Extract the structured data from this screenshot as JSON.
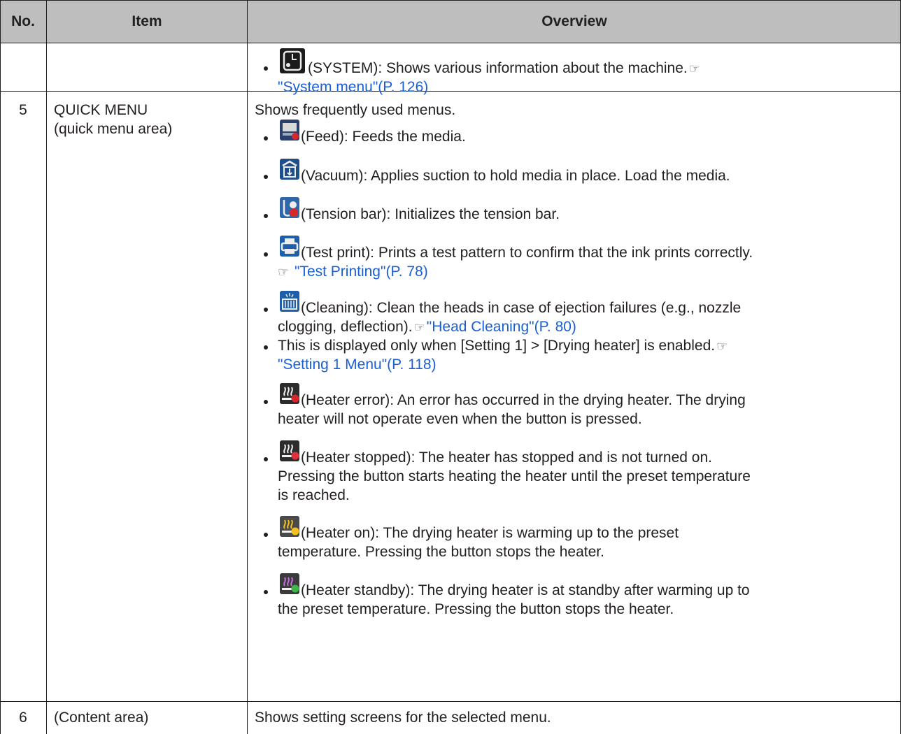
{
  "table": {
    "headers": {
      "no": "No.",
      "item": "Item",
      "overview": "Overview"
    },
    "rows": [
      {
        "no": "",
        "item_lines": [
          "",
          ""
        ],
        "overview": {
          "intro": "",
          "bullets": [
            {
              "icon": "system-icon",
              "text": "(SYSTEM): Shows various information about the machine.",
              "ref_glyph": "☞",
              "link": "\"System menu\"(P. 126)"
            }
          ]
        }
      },
      {
        "no": "5",
        "item_lines": [
          "QUICK MENU",
          "(quick menu area)"
        ],
        "overview": {
          "intro": "Shows frequently used menus.",
          "bullets": [
            {
              "icon": "feed-icon",
              "text": "(Feed): Feeds the media."
            },
            {
              "icon": "vacuum-icon",
              "text": "(Vacuum): Applies suction to hold media in place. Load the media."
            },
            {
              "icon": "tension-bar-icon",
              "text": "(Tension bar): Initializes the tension bar."
            },
            {
              "icon": "test-print-icon",
              "text": "(Test print): Prints a test pattern to confirm that the ink prints correctly.",
              "ref_glyph": "☞",
              "link": "\"Test Printing\"(P. 78)"
            },
            {
              "icon": "cleaning-icon",
              "text_line1": "(Cleaning): Clean the heads in case of ejection failures (e.g., nozzle",
              "text_line2": "clogging, deflection).",
              "ref_glyph": "☞",
              "link": "\"Head Cleaning\"(P. 80)"
            },
            {
              "icon": "",
              "text": "This is displayed only when [Setting 1] > [Drying heater] is enabled.",
              "ref_glyph": "☞",
              "link": "\"Setting 1 Menu\"(P. 118)"
            },
            {
              "icon": "heater-error-icon",
              "text_line1": "(Heater error): An error has occurred in the drying heater. The drying",
              "text_line2": "heater will not operate even when the button is pressed."
            },
            {
              "icon": "heater-stopped-icon",
              "text_line1": "(Heater stopped): The heater has stopped and is not turned on.",
              "text_line2": "Pressing the button starts heating the heater until the preset temperature",
              "text_line3": "is reached."
            },
            {
              "icon": "heater-on-icon",
              "text_line1": "(Heater on): The drying heater is warming up to the preset",
              "text_line2": "temperature. Pressing the button stops the heater."
            },
            {
              "icon": "heater-standby-icon",
              "text_line1": "(Heater standby): The drying heater is at standby after warming up to",
              "text_line2": "the preset temperature. Pressing the button stops the heater."
            }
          ]
        }
      },
      {
        "no": "6",
        "item_lines": [
          "(Content area)"
        ],
        "overview": {
          "intro": "Shows setting screens for the selected menu."
        }
      }
    ]
  },
  "colors": {
    "header_bg": "#bebebe",
    "link": "#1a5fd6",
    "text": "#231f20"
  }
}
